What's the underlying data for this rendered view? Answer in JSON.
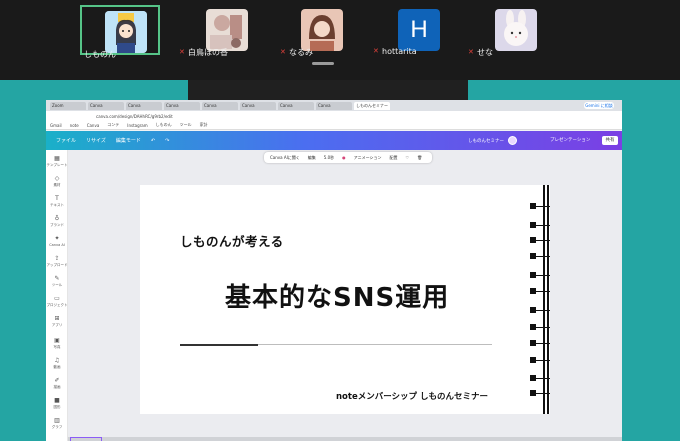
{
  "participants": [
    {
      "name": "しものん",
      "muted": false,
      "active": true,
      "avatar": "anime-girl-avatar"
    },
    {
      "name": "白鳥ほの香",
      "muted": true,
      "active": false,
      "avatar": "photo-avatar"
    },
    {
      "name": "なるみ",
      "muted": true,
      "active": false,
      "avatar": "illustration-avatar"
    },
    {
      "name": "hottarita",
      "muted": true,
      "active": false,
      "avatar": "letter-avatar",
      "initial": "H"
    },
    {
      "name": "せな",
      "muted": true,
      "active": false,
      "avatar": "bunny-avatar"
    }
  ],
  "browser": {
    "tabs": [
      "Zoom",
      "Canva",
      "Canva",
      "Canva",
      "Canva",
      "Canva",
      "Canva",
      "Canva",
      "しものんセミナー"
    ],
    "new_tab_label": "Gemini に相談",
    "url": "canva.com/design/DAHhRC/g9rb2/edit",
    "bookmarks": [
      "Gmail",
      "note",
      "Canva",
      "コンテ",
      "Instagram",
      "しものん",
      "ツール",
      "家計"
    ]
  },
  "canva": {
    "menu": [
      "ファイル",
      "リサイズ",
      "編集モード"
    ],
    "project_title": "しものんセミナー",
    "present_label": "プレゼンテーション",
    "share_label": "共有",
    "sidebar": [
      "テンプレート",
      "素材",
      "テキスト",
      "ブランド",
      "Canva AI",
      "アップロード",
      "ツール",
      "プロジェクト",
      "アプリ",
      "写真",
      "動画",
      "描画",
      "図形",
      "グラフ"
    ],
    "context_toolbar": [
      "Canva AIに聞く",
      "編集",
      "5.0秒",
      "アニメーション",
      "配置"
    ]
  },
  "slide": {
    "subtitle": "しものんが考える",
    "title": "基本的なSNS運用",
    "footer": "noteメンバーシップ しものんセミナー"
  }
}
